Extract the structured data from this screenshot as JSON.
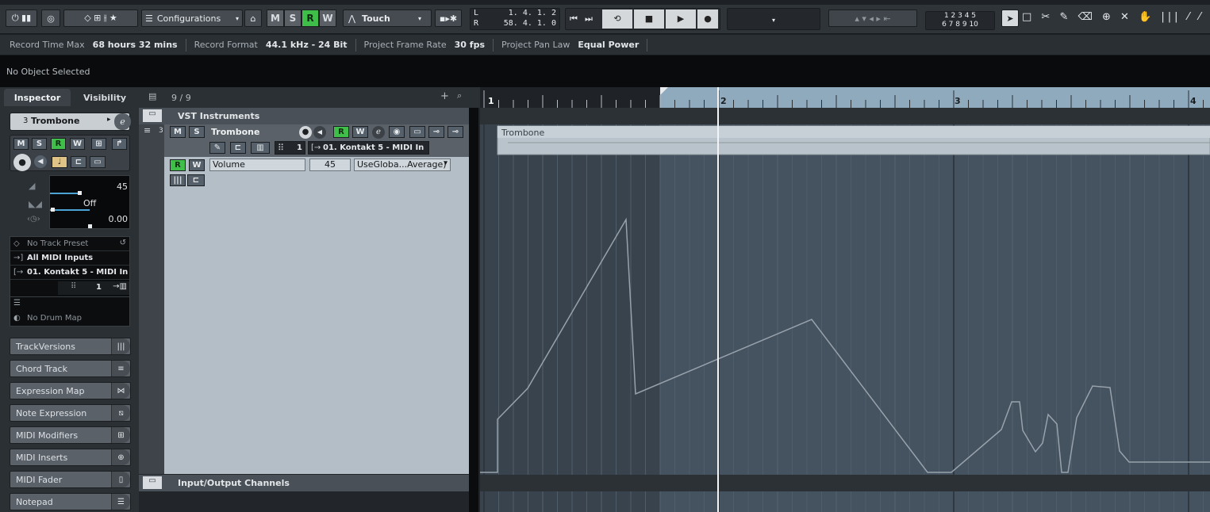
{
  "toolbar": {
    "configurations_label": "Configurations",
    "m_label": "M",
    "s_label": "S",
    "r_label": "R",
    "w_label": "W",
    "automation_mode": "Touch",
    "locator_left_label": "L",
    "locator_right_label": "R",
    "locator_left_value": "1. 4. 1. 2",
    "locator_right_value": "58. 4. 1. 0",
    "marker_row1": "1 2 3 4 5",
    "marker_row2": "6 7 8 9 10"
  },
  "info_line": {
    "items": [
      {
        "label": "Record Time Max",
        "value": "68 hours 32 mins"
      },
      {
        "label": "Record Format",
        "value": "44.1 kHz - 24 Bit"
      },
      {
        "label": "Project Frame Rate",
        "value": "30 fps"
      },
      {
        "label": "Project Pan Law",
        "value": "Equal Power"
      }
    ]
  },
  "status_line": {
    "text": "No Object Selected"
  },
  "inspector": {
    "tab_inspector": "Inspector",
    "tab_visibility": "Visibility",
    "track_number": "3",
    "track_name": "Trombone",
    "btn_m": "M",
    "btn_s": "S",
    "btn_r": "R",
    "btn_w": "W",
    "volume_value": "45",
    "pan_value": "Off",
    "delay_value": "0.00",
    "track_preset": "No Track Preset",
    "midi_input": "All MIDI Inputs",
    "midi_output": "01. Kontakt 5 - MIDI In",
    "channel": "1",
    "drum_map": "No Drum Map",
    "sections": [
      "TrackVersions",
      "Chord Track",
      "Expression Map",
      "Note Expression",
      "MIDI Modifiers",
      "MIDI Inserts",
      "MIDI Fader",
      "Notepad"
    ],
    "section_icons": [
      "versions-icon",
      "chord-icon",
      "expression-map-icon",
      "note-expression-icon",
      "modifiers-icon",
      "inserts-icon",
      "fader-icon",
      "notepad-icon"
    ]
  },
  "tracklist": {
    "count": "9 / 9",
    "folder_name": "VST Instruments",
    "track_number": "3",
    "track_name": "Trombone",
    "track_channel": "1",
    "track_output": "01. Kontakt 5 - MIDI In",
    "auto_param": "Volume",
    "auto_value": "45",
    "auto_mode": "UseGloba...Average)",
    "io_folder": "Input/Output Channels"
  },
  "arrange": {
    "ruler_labels": [
      "1",
      "2",
      "3",
      "4"
    ],
    "part_name": "Trombone",
    "colors": {
      "part": "#b9c3cb",
      "bg_selected": "#46525f",
      "automation_line": "#97a2ac"
    }
  }
}
